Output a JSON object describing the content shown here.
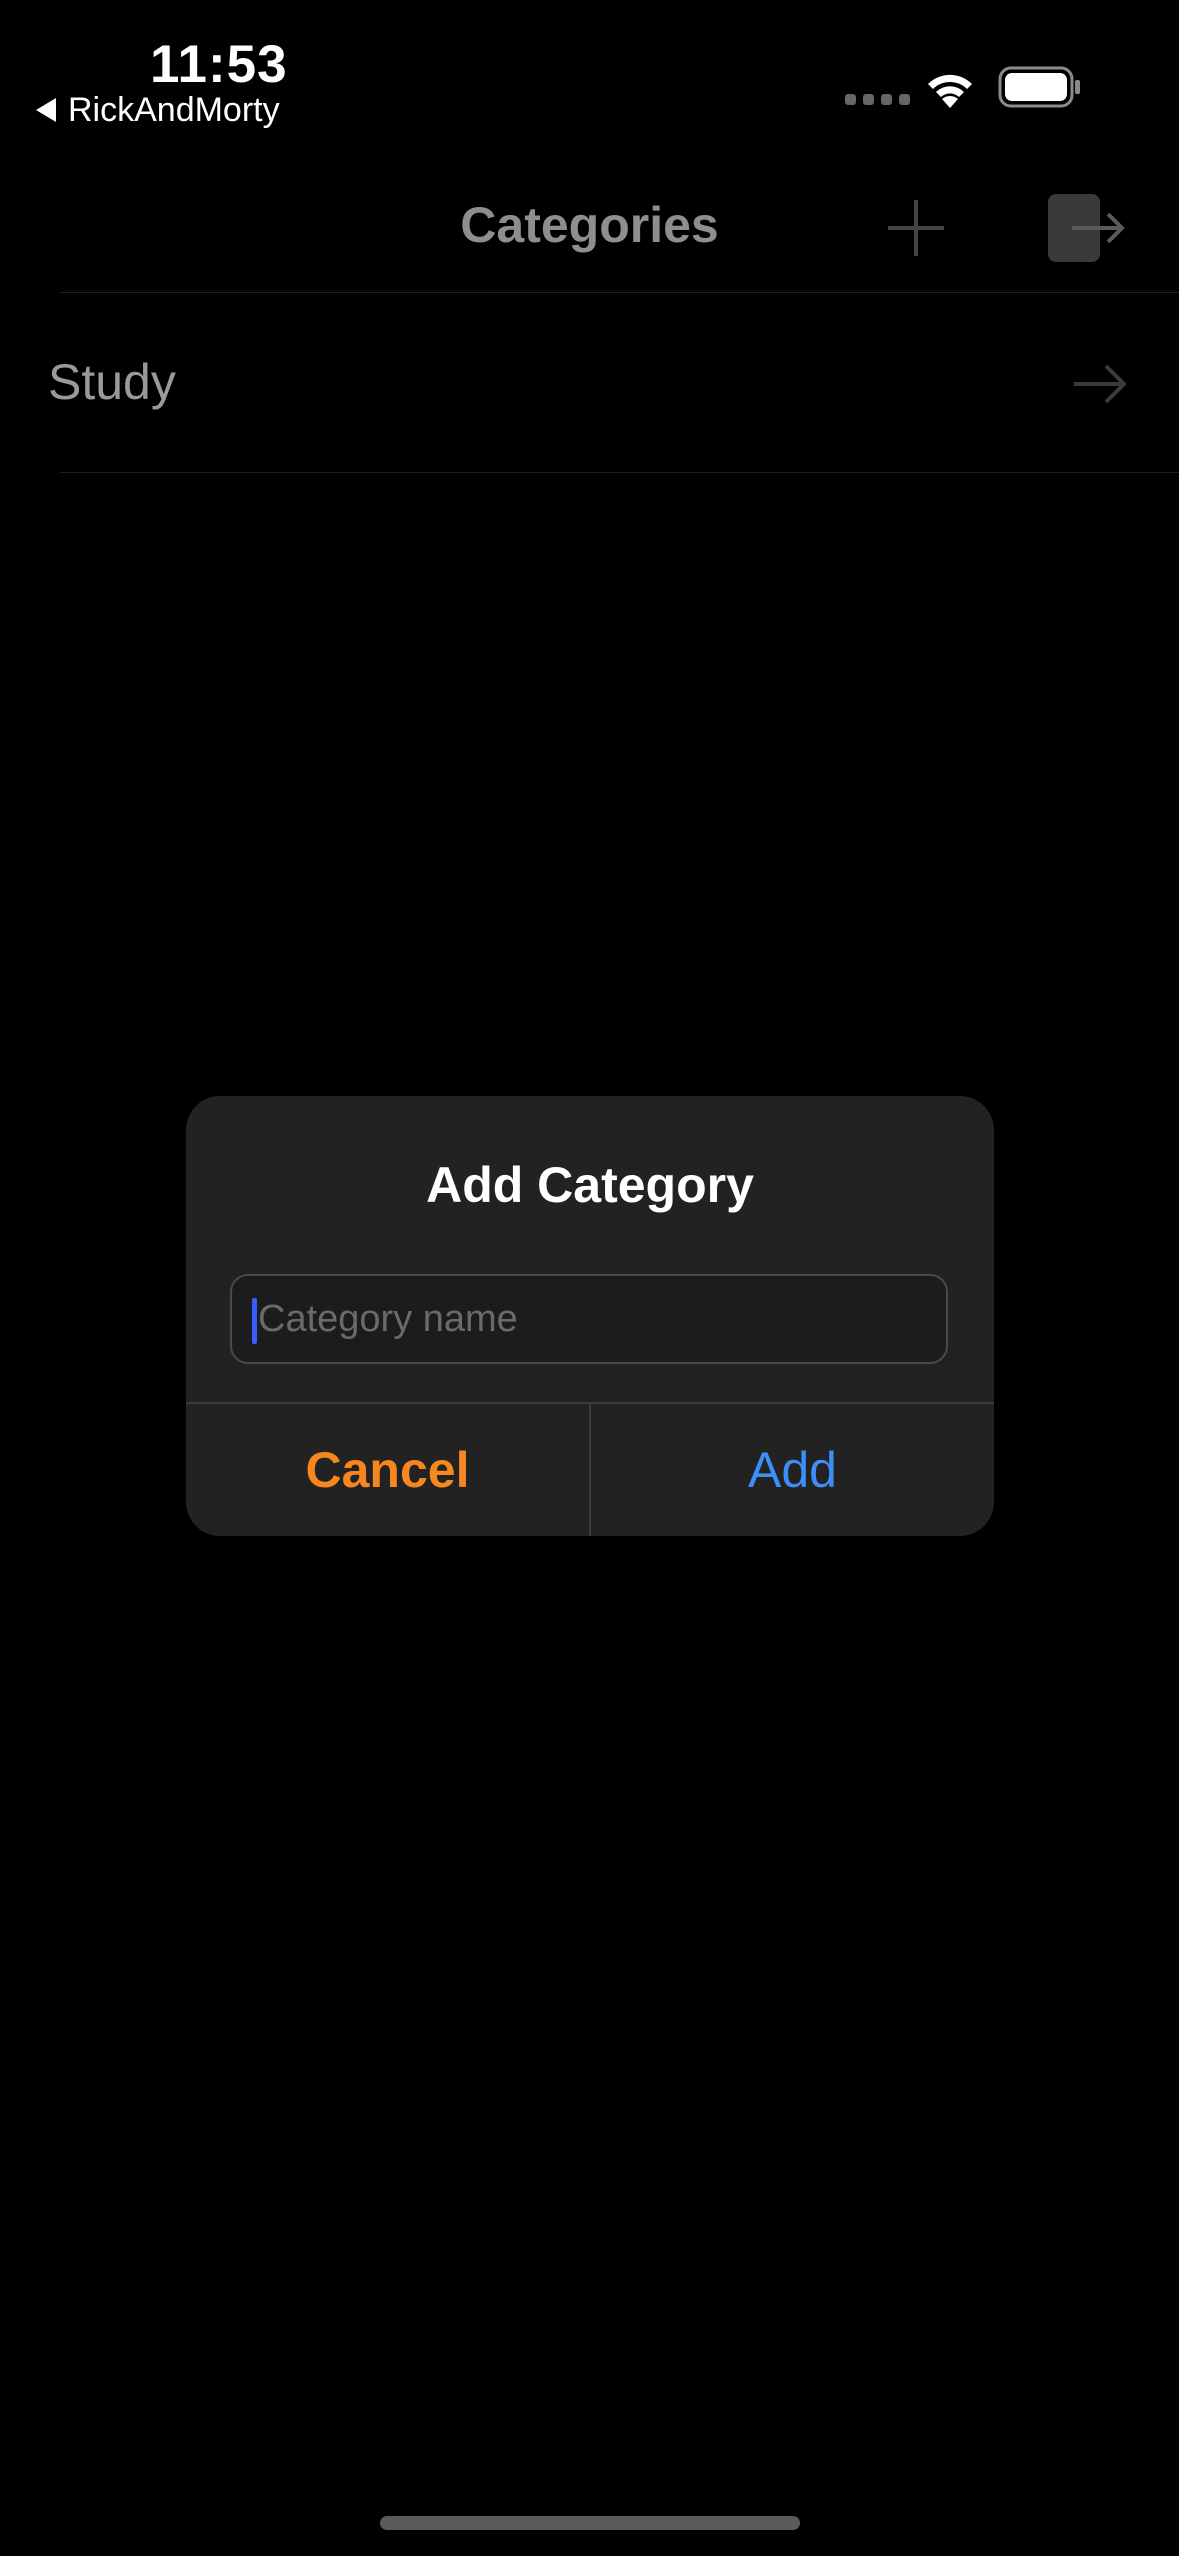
{
  "status_bar": {
    "time": "11:53",
    "back_app": "RickAndMorty",
    "icons": [
      "back-triangle-icon",
      "signal-dots-icon",
      "wifi-icon",
      "battery-icon"
    ]
  },
  "nav": {
    "title": "Categories",
    "add_icon": "plus-icon",
    "logout_icon": "logout-icon"
  },
  "categories": [
    {
      "label": "Study",
      "icon": "arrow-right-icon"
    }
  ],
  "alert": {
    "title": "Add Category",
    "input_placeholder": "Category name",
    "input_value": "",
    "cancel_label": "Cancel",
    "add_label": "Add"
  },
  "colors": {
    "background": "#000000",
    "alert_background": "#222222",
    "cancel": "#f6861f",
    "add": "#3e8ef7",
    "caret": "#3b5bff"
  }
}
